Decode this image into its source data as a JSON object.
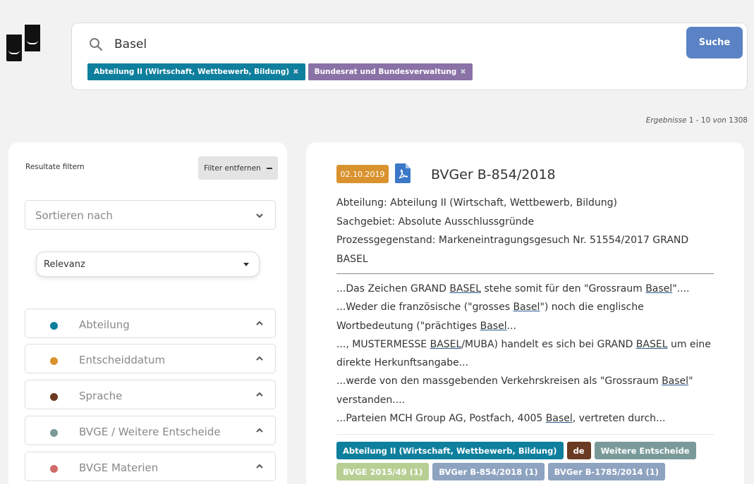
{
  "search": {
    "value": "Basel",
    "button_label": "Suche",
    "filters": [
      {
        "label": "Abteilung II (Wirtschaft, Wettbewerb, Bildung)",
        "color": "#0e7f9d"
      },
      {
        "label": "Bundesrat und Bundesverwaltung",
        "color": "#8a71a6"
      }
    ]
  },
  "results_count": {
    "prefix": "Ergebnisse",
    "range": "1 - 10",
    "of_label": "von",
    "total": "1308"
  },
  "sidebar": {
    "title": "Resultate filtern",
    "remove_filters_label": "Filter entfernen",
    "remove_filters_icon": "minus-icon",
    "sort_label": "Sortieren nach",
    "sort_value": "Relevanz",
    "facets": [
      {
        "label": "Abteilung",
        "color": "#0e7f9d"
      },
      {
        "label": "Entscheiddatum",
        "color": "#d9922e"
      },
      {
        "label": "Sprache",
        "color": "#6a3a22"
      },
      {
        "label": "BVGE / Weitere Entscheide",
        "color": "#7a9a9a"
      },
      {
        "label": "BVGE Materien",
        "color": "#d06a6a"
      }
    ]
  },
  "result": {
    "date": "02.10.2019",
    "date_color": "#d9922e",
    "title": "BVGer B-854/2018",
    "meta": [
      "Abteilung: Abteilung II (Wirtschaft, Wettbewerb, Bildung)",
      "Sachgebiet: Absolute Ausschlussgründe",
      "Prozessgegenstand: Markeneintragungsgesuch Nr. 51554/2017 GRAND BASEL"
    ],
    "snippets": [
      [
        "...Das Zeichen GRAND ",
        {
          "hl": "BASEL"
        },
        " stehe somit für den \"Grossraum ",
        {
          "hl": "Basel"
        },
        "\"...."
      ],
      [
        "...Weder die französische (\"grosses ",
        {
          "hl": "Basel"
        },
        "\") noch die englische Wortbedeutung (\"prächtiges ",
        {
          "hl": "Basel"
        },
        "..."
      ],
      [
        "..., MUSTERMESSE ",
        {
          "hl": "BASEL"
        },
        "/MUBA) handelt es sich bei GRAND ",
        {
          "hl": "BASEL"
        },
        " um eine direkte Herkunftsangabe..."
      ],
      [
        "...werde von den massgebenden Verkehrskreisen als \"Grossraum ",
        {
          "hl": "Basel"
        },
        "\" verstanden...."
      ],
      [
        "...Parteien MCH Group AG, Postfach, 4005 ",
        {
          "hl": "Basel"
        },
        ", vertreten durch..."
      ]
    ],
    "tags_row1": [
      {
        "label": "Abteilung II (Wirtschaft, Wettbewerb, Bildung)",
        "color": "#0e7f9d"
      },
      {
        "label": "de",
        "color": "#6a3a22"
      },
      {
        "label": "Weitere Entscheide",
        "color": "#7a9a9a"
      }
    ],
    "tags_row2": [
      {
        "label": "BVGE 2015/49 (1)",
        "color": "#b7cf93"
      },
      {
        "label": "BVGer B-854/2018 (1)",
        "color": "#8ea3c0"
      },
      {
        "label": "BVGer B-1785/2014 (1)",
        "color": "#8ea3c0"
      }
    ]
  }
}
